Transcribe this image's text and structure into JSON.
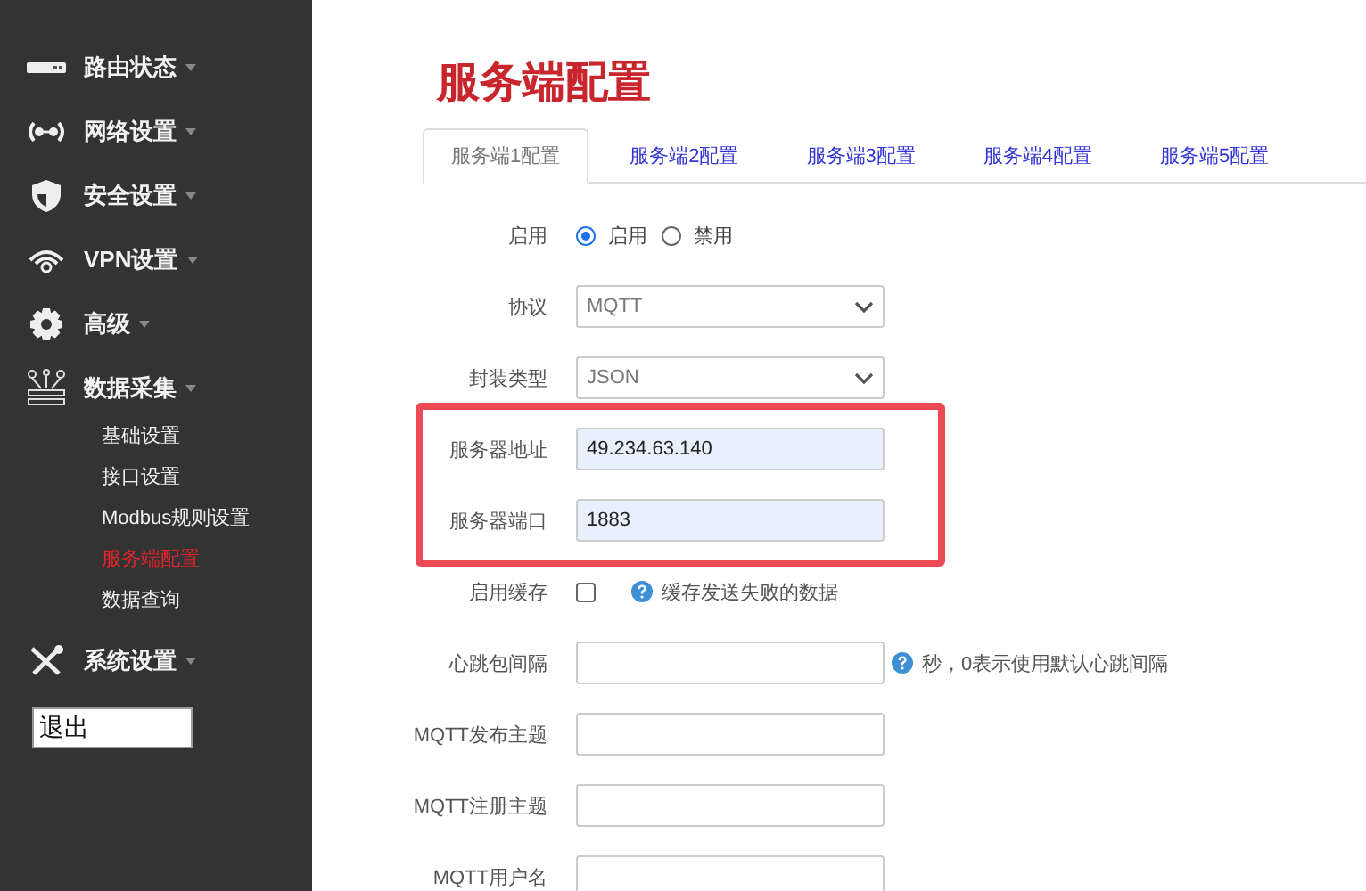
{
  "sidebar": {
    "items": [
      {
        "label": "路由状态"
      },
      {
        "label": "网络设置"
      },
      {
        "label": "安全设置"
      },
      {
        "label": "VPN设置"
      },
      {
        "label": "高级"
      },
      {
        "label": "数据采集",
        "children": [
          {
            "label": "基础设置",
            "selected": false
          },
          {
            "label": "接口设置",
            "selected": false
          },
          {
            "label": "Modbus规则设置",
            "selected": false
          },
          {
            "label": "服务端配置",
            "selected": true
          },
          {
            "label": "数据查询",
            "selected": false
          }
        ]
      },
      {
        "label": "系统设置"
      }
    ],
    "logout": {
      "label": "退出"
    }
  },
  "page": {
    "title": "服务端配置",
    "tabs": [
      {
        "label": "服务端1配置",
        "selected": true
      },
      {
        "label": "服务端2配置",
        "selected": false
      },
      {
        "label": "服务端3配置",
        "selected": false
      },
      {
        "label": "服务端4配置",
        "selected": false
      },
      {
        "label": "服务端5配置",
        "selected": false
      }
    ],
    "rows": [
      {
        "kind": "radio",
        "label": "启用",
        "highlighted": false,
        "options": [
          {
            "label": "启用",
            "selected": true
          },
          {
            "label": "禁用",
            "selected": false
          }
        ]
      },
      {
        "kind": "select",
        "label": "协议",
        "highlighted": false,
        "value": "MQTT"
      },
      {
        "kind": "select",
        "label": "封装类型",
        "highlighted": false,
        "value": "JSON"
      },
      {
        "kind": "text",
        "label": "服务器地址",
        "highlighted": true,
        "value": "49.234.63.140"
      },
      {
        "kind": "text",
        "label": "服务器端口",
        "highlighted": true,
        "value": "1883"
      },
      {
        "kind": "checkbox",
        "label": "启用缓存",
        "highlighted": false,
        "checked": false,
        "help": "缓存发送失败的数据"
      },
      {
        "kind": "text",
        "label": "心跳包间隔",
        "highlighted": false,
        "help": "秒，0表示使用默认心跳间隔"
      },
      {
        "kind": "text",
        "label": "MQTT发布主题",
        "highlighted": false
      },
      {
        "kind": "text",
        "label": "MQTT注册主题",
        "highlighted": false
      },
      {
        "kind": "text",
        "label": "MQTT用户名",
        "highlighted": false
      }
    ]
  }
}
